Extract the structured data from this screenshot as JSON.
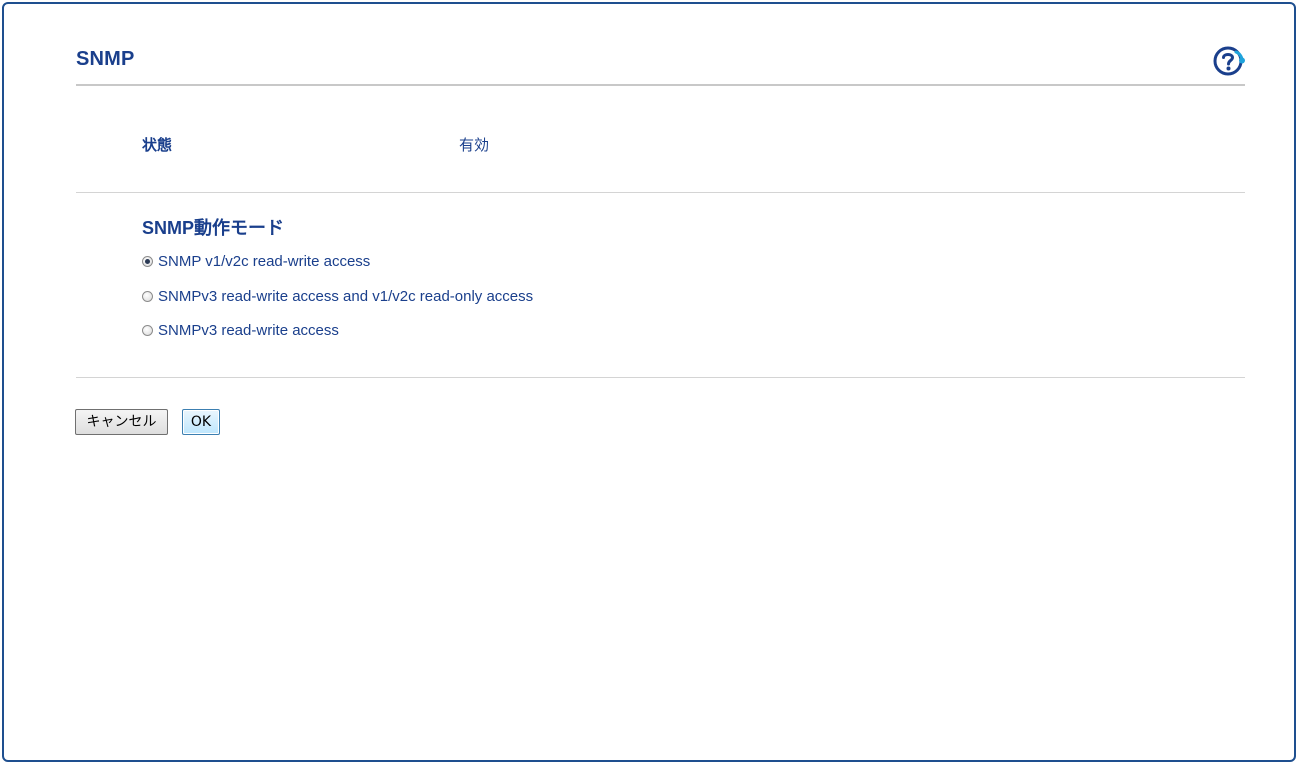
{
  "page": {
    "title": "SNMP",
    "help_icon": "help-question-icon"
  },
  "status": {
    "label": "状態",
    "value": "有効"
  },
  "mode_section": {
    "heading": "SNMP動作モード",
    "options": [
      {
        "label": "SNMP v1/v2c read-write access",
        "selected": true
      },
      {
        "label": "SNMPv3 read-write access and v1/v2c read-only access",
        "selected": false
      },
      {
        "label": "SNMPv3 read-write access",
        "selected": false
      }
    ]
  },
  "buttons": {
    "cancel_label": "キャンセル",
    "ok_label": "OK"
  },
  "colors": {
    "text_blue": "#1a3f8c",
    "frame_border": "#1e4f8f",
    "help_icon_accent": "#1fa3dc"
  }
}
